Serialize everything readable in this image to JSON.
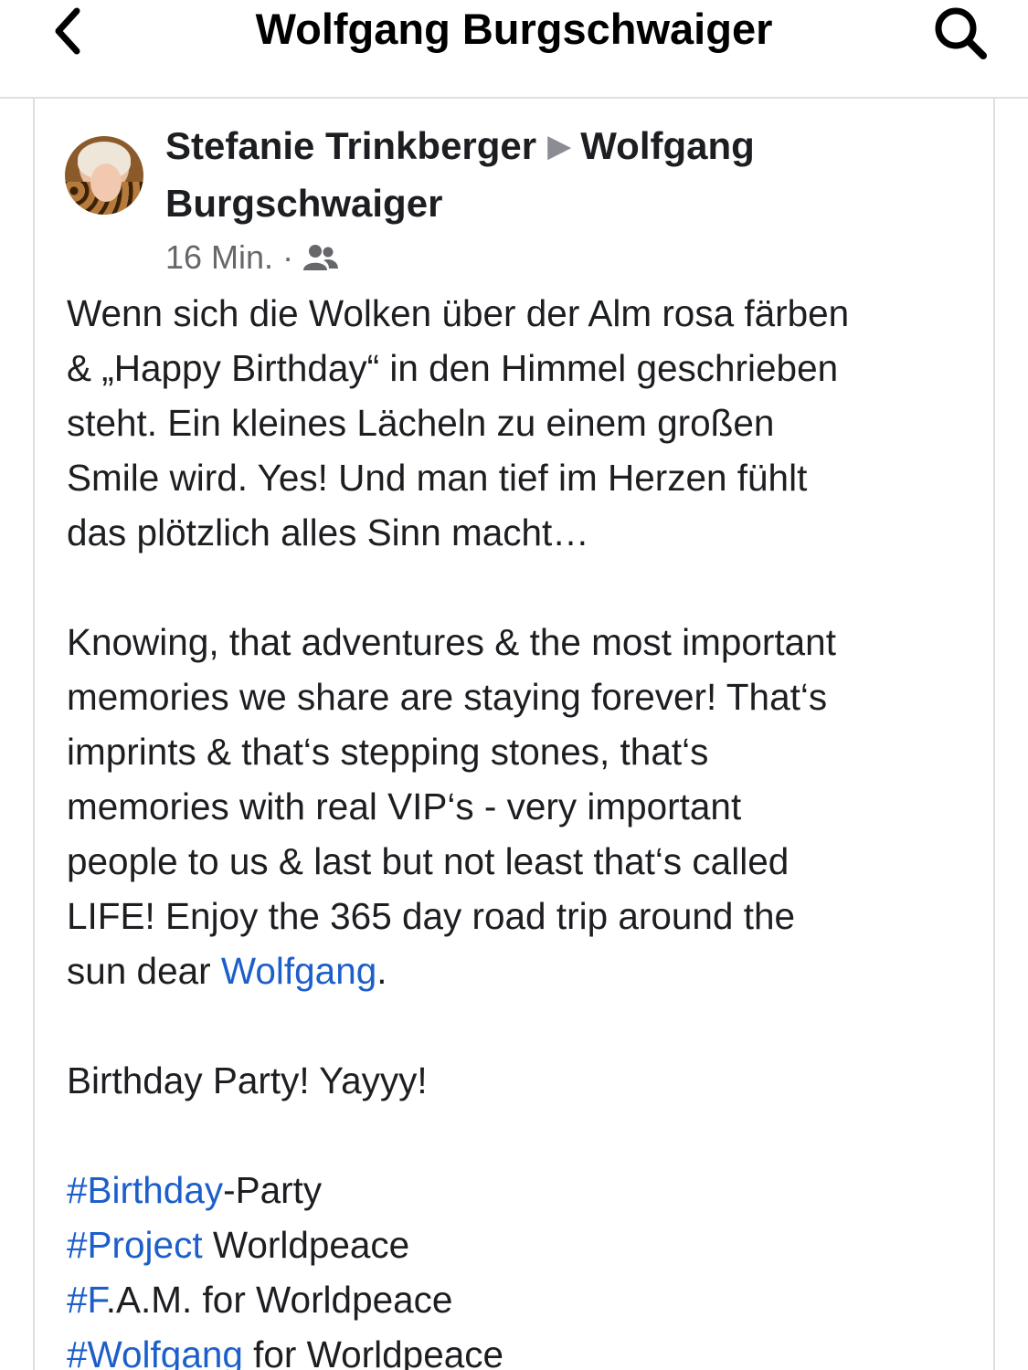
{
  "header": {
    "title": "Wolfgang Burgschwaiger",
    "back_icon": "chevron-left-icon",
    "search_icon": "search-icon"
  },
  "post": {
    "author": "Stefanie Trinkberger",
    "target_line1": "Wolfgang",
    "target_line2": "Burgschwaiger",
    "time": "16 Min.",
    "separator": "·",
    "audience_icon": "friends-icon",
    "paragraph1": [
      "Wenn sich die Wolken über der Alm rosa färben",
      "& „Happy Birthday“ in den Himmel geschrieben",
      "steht. Ein kleines Lächeln zu einem großen",
      "Smile wird. Yes! Und man tief im Herzen fühlt",
      "das plötzlich alles Sinn macht…"
    ],
    "paragraph2": [
      "Knowing, that adventures & the most important",
      "memories we share are staying forever! That‘s",
      "imprints & that‘s stepping stones, that‘s",
      "memories with real VIP‘s - very important",
      "people to us & last but not least that‘s called",
      "LIFE! Enjoy the 365 day road trip around the"
    ],
    "paragraph2_last_prefix": "sun dear ",
    "paragraph2_mention": "Wolfgang",
    "paragraph2_last_suffix": ".",
    "paragraph3": "Birthday Party! Yayyy!",
    "hashtags": [
      {
        "tag": "#Birthday",
        "rest": "-Party"
      },
      {
        "tag": "#Project",
        "rest": " Worldpeace"
      },
      {
        "tag": "#F",
        "rest": ".A.M. for Worldpeace"
      },
      {
        "tag": "#Wolfgang",
        "rest": " for Worldpeace"
      }
    ]
  },
  "colors": {
    "link": "#1d5fca",
    "text": "#1c1e21",
    "muted": "#65676b",
    "divider": "#dddfe2"
  }
}
